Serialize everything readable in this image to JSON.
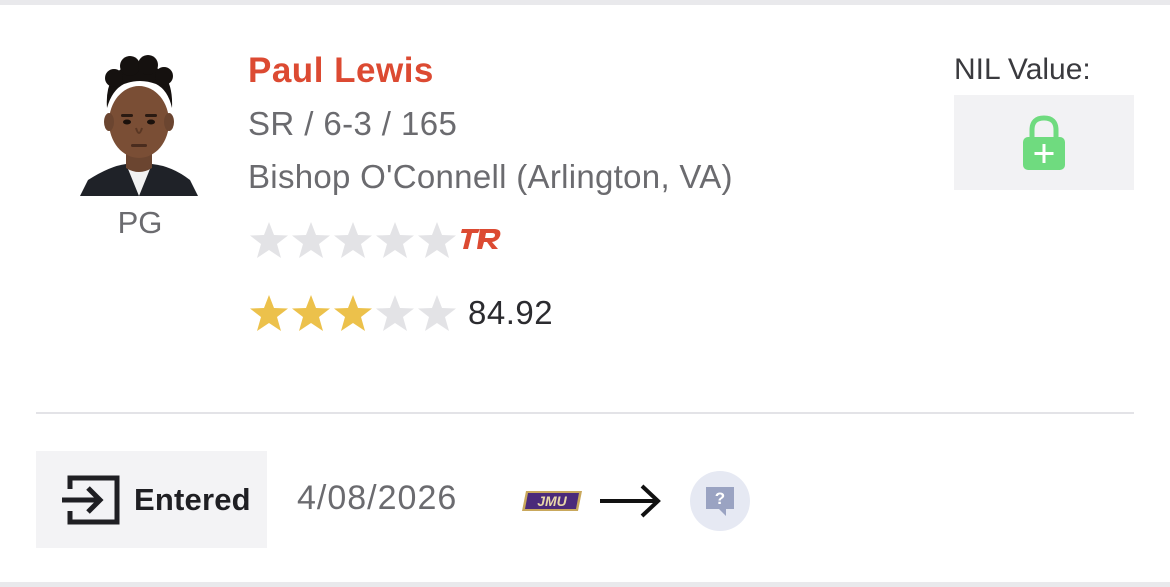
{
  "player": {
    "name": "Paul Lewis",
    "position": "PG",
    "bio": "SR / 6-3 / 165",
    "school": "Bishop O'Connell (Arlington, VA)",
    "tr_star_rating": 0,
    "composite_star_rating": 3,
    "max_stars": 5,
    "composite_score": "84.92"
  },
  "nil": {
    "label": "NIL Value:",
    "icon": "lock-plus-icon"
  },
  "transfer": {
    "status_label": "Entered",
    "status_icon": "enter-icon",
    "date": "4/08/2026",
    "from_school_logo": "JMU",
    "arrow_icon": "arrow-right-icon",
    "destination_icon": "unknown-school-icon",
    "destination_glyph": "?"
  },
  "colors": {
    "name": "#dc4a32",
    "star_filled": "#ecc14b",
    "star_empty": "#e3e3e6",
    "tr_logo": "#dc4a32",
    "lock": "#6fdb7f",
    "jmu_purple": "#4b2a7a",
    "jmu_gold": "#c9a85c"
  }
}
